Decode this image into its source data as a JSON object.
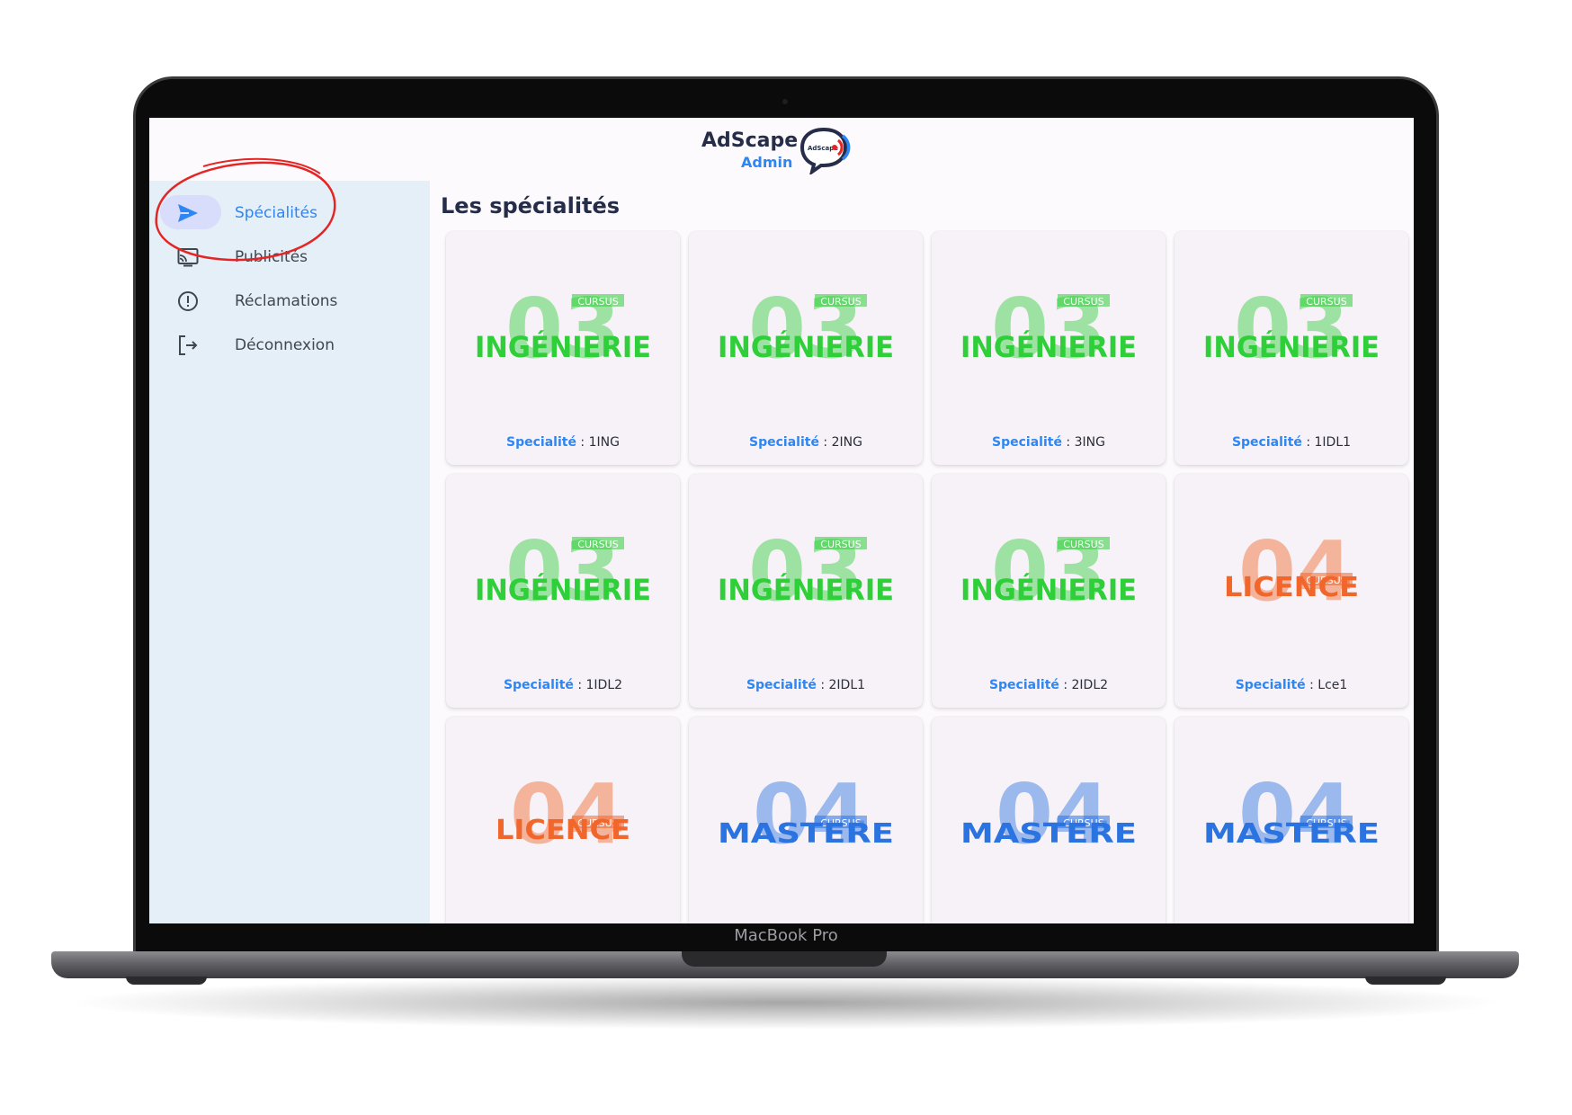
{
  "device": {
    "label": "MacBook Pro"
  },
  "header": {
    "app_name": "AdScape",
    "subtitle": "Admin",
    "logo_text": "AdScape"
  },
  "sidebar": {
    "items": [
      {
        "label": "Spécialités",
        "icon": "send-icon",
        "active": true
      },
      {
        "label": "Publicités",
        "icon": "cast-icon",
        "active": false
      },
      {
        "label": "Réclamations",
        "icon": "alert-circle-icon",
        "active": false
      },
      {
        "label": "Déconnexion",
        "icon": "logout-icon",
        "active": false
      }
    ]
  },
  "main": {
    "title": "Les spécialités"
  },
  "card_key": "Specialité",
  "logo_texts": {
    "ing": {
      "big": "03",
      "small": "CURSUS",
      "word": "INGÉNIERIE"
    },
    "lic": {
      "big": "04",
      "small": "CURSUS",
      "word": "LICENCE"
    },
    "mas": {
      "big": "04",
      "small": "CURSUS",
      "word": "MASTERE"
    }
  },
  "colors": {
    "accent": "#2e86f2",
    "ingenierie": "#2fcf3a",
    "licence": "#f0662b",
    "mastere": "#2a73e0",
    "annotation": "#e52424"
  },
  "cards": [
    {
      "value": "1ING",
      "kind": "ing"
    },
    {
      "value": "2ING",
      "kind": "ing"
    },
    {
      "value": "3ING",
      "kind": "ing"
    },
    {
      "value": "1IDL1",
      "kind": "ing"
    },
    {
      "value": "1IDL2",
      "kind": "ing"
    },
    {
      "value": "2IDL1",
      "kind": "ing"
    },
    {
      "value": "2IDL2",
      "kind": "ing"
    },
    {
      "value": "Lce1",
      "kind": "lic"
    },
    {
      "value": "",
      "kind": "lic"
    },
    {
      "value": "",
      "kind": "mas"
    },
    {
      "value": "",
      "kind": "mas"
    },
    {
      "value": "",
      "kind": "mas"
    }
  ]
}
